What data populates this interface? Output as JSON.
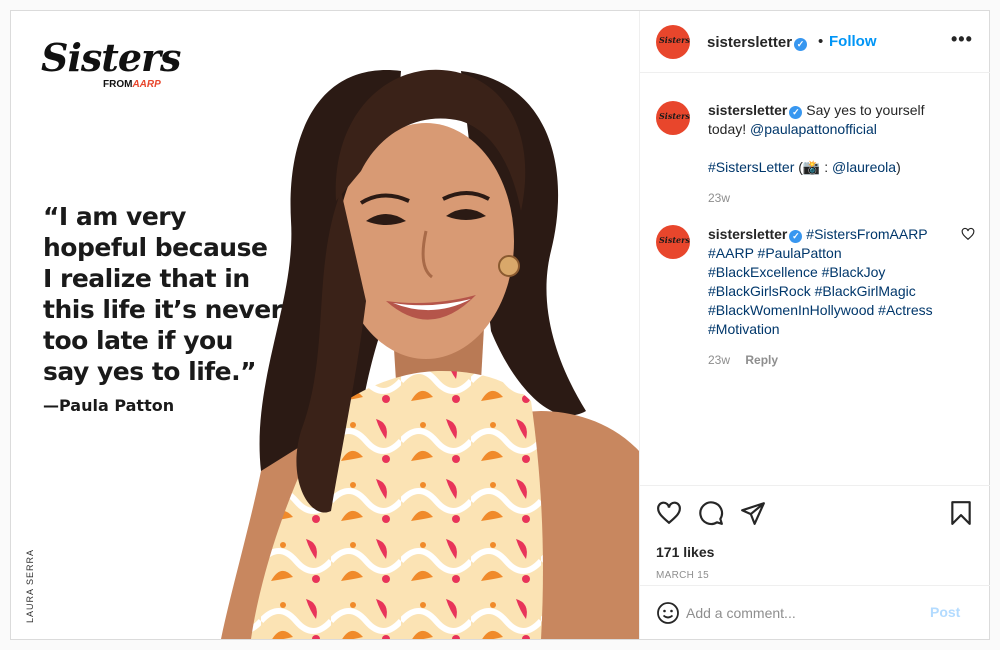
{
  "media": {
    "brand_main": "Sisters",
    "brand_from": "FROM",
    "brand_aarp": "AARP",
    "quote_lines": [
      "“I am very",
      "hopeful because",
      "I realize that in",
      "this life it’s never",
      "too late if you",
      "say yes to life.”"
    ],
    "author": "—Paula Patton",
    "artist": "LAURA SERRA"
  },
  "header": {
    "avatar_text": "Sisters",
    "username": "sistersletter",
    "dot": "•",
    "follow_label": "Follow",
    "more_icon": "more-horizontal-icon"
  },
  "comments": [
    {
      "username": "sistersletter",
      "text_1": "Say yes to yourself today!",
      "mention": "@paulapattonofficial",
      "hashtag": "#SistersLetter",
      "credit_open": "(📸 :",
      "credit_mention": "@laureola",
      "credit_close": ")",
      "time": "23w"
    },
    {
      "username": "sistersletter",
      "hashtags": "#SistersFromAARP #AARP #PaulaPatton #BlackExcellence #BlackJoy #BlackGirlsRock #BlackGirlMagic #BlackWomenInHollywood #Actress #Motivation",
      "time": "23w",
      "reply_label": "Reply"
    }
  ],
  "actions": {
    "likes": "171 likes",
    "date": "MARCH 15"
  },
  "add_comment": {
    "placeholder": "Add a comment...",
    "post_label": "Post"
  },
  "colors": {
    "accent": "#0095f6",
    "brand": "#e8462c",
    "link": "#00376b",
    "muted": "#8e8e8e"
  }
}
